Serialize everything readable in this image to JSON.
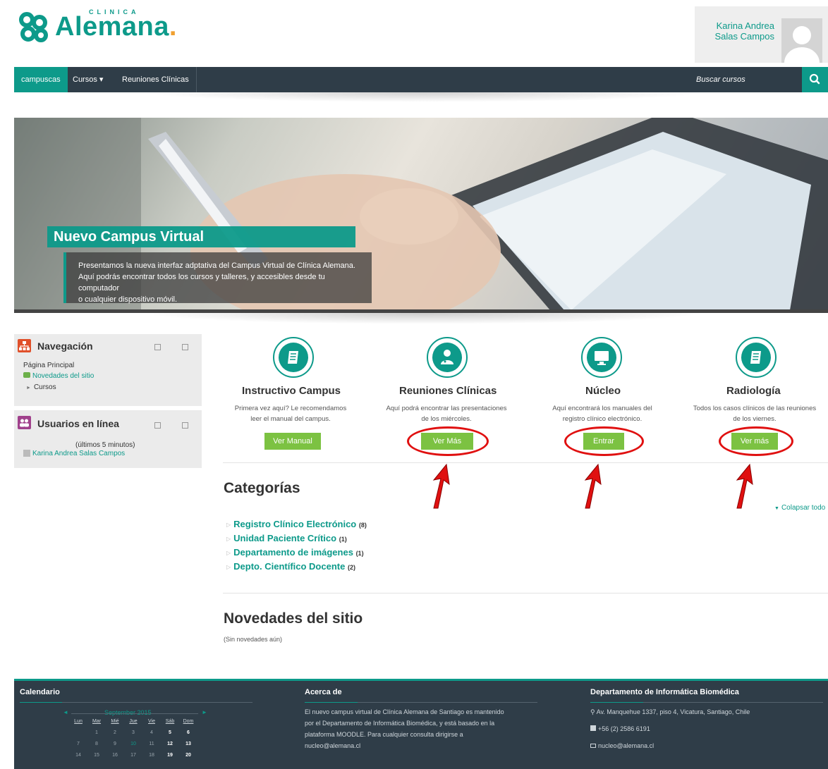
{
  "header": {
    "logo_small": "CLINICA",
    "logo_big": "Alemana",
    "logo_dot": ".",
    "user_line1": "Karina Andrea",
    "user_line2": "Salas Campos"
  },
  "navbar": {
    "home": "campuscas",
    "courses": "Cursos ▾",
    "meetings": "Reuniones Clínicas",
    "search_placeholder": "Buscar cursos"
  },
  "hero": {
    "title": "Nuevo Campus Virtual",
    "caption_line1": "Presentamos la nueva interfaz adptativa del Campus Virtual de Clínica Alemana.",
    "caption_line2": "Aquí podrás encontrar todos los cursos y talleres, y accesibles desde tu computador",
    "caption_line3": "o cualquier dispositivo móvil."
  },
  "nav_block": {
    "title": "Navegación",
    "home": "Página Principal",
    "news": "Novedades del sitio",
    "courses": "Cursos"
  },
  "users_block": {
    "title": "Usuarios en línea",
    "subtitle": "(últimos 5 minutos)",
    "user": "Karina Andrea Salas Campos"
  },
  "features": [
    {
      "title": "Instructivo Campus",
      "desc1": "Primera vez aquí? Le recomendamos",
      "desc2": "leer el manual del campus.",
      "button": "Ver Manual",
      "icon": "book-icon"
    },
    {
      "title": "Reuniones Clínicas",
      "desc1": "Aquí podrá encontrar las presentaciones",
      "desc2": "de los miércoles.",
      "button": "Ver Más",
      "icon": "doctor-icon"
    },
    {
      "title": "Núcleo",
      "desc1": "Aquí encontrará los manuales del",
      "desc2": "registro clínico electrónico.",
      "button": "Entrar",
      "icon": "monitor-icon"
    },
    {
      "title": "Radiología",
      "desc1": "Todos los casos clínicos de las reuniones",
      "desc2": "de los viernes.",
      "button": "Ver más",
      "icon": "book-icon"
    }
  ],
  "categories": {
    "title": "Categorías",
    "collapse": "Colapsar todo",
    "items": [
      {
        "name": "Registro Clínico Electrónico",
        "count": "(8)"
      },
      {
        "name": "Unidad Paciente Crítico",
        "count": "(1)"
      },
      {
        "name": "Departamento de imágenes",
        "count": "(1)"
      },
      {
        "name": "Depto. Científico Docente",
        "count": "(2)"
      }
    ]
  },
  "news": {
    "title": "Novedades del sitio",
    "empty": "(Sin novedades aún)"
  },
  "footer": {
    "calendar_title": "Calendario",
    "month": "September 2015",
    "prev": "◄",
    "next": "►",
    "weekdays": [
      "Lun",
      "Mar",
      "Mié",
      "Jue",
      "Vie",
      "Sáb",
      "Dom"
    ],
    "weeks": [
      [
        "",
        "1",
        "2",
        "3",
        "4",
        "5",
        "6"
      ],
      [
        "7",
        "8",
        "9",
        "10",
        "11",
        "12",
        "13"
      ],
      [
        "14",
        "15",
        "16",
        "17",
        "18",
        "19",
        "20"
      ]
    ],
    "about_title": "Acerca de",
    "about_line1": "El nuevo campus virtual de Clínica Alemana de Santiago es mantenido",
    "about_line2": "por el Departamento de Informática Biomédica, y está basado en la",
    "about_line3": "plataforma MOODLE. Para cualquier consulta dirigirse a",
    "about_line4": "nucleo@alemana.cl",
    "dept_title": "Departamento de Informática Biomédica",
    "address": "Av. Manquehue 1337, piso 4, Vicatura, Santiago, Chile",
    "phone": "+56 (2) 2586 6191",
    "email": "nucleo@alemana.cl"
  },
  "colors": {
    "accent": "#0d9a8a",
    "navbar": "#2f3d48",
    "button": "#7cc242",
    "highlight": "#e01010"
  }
}
